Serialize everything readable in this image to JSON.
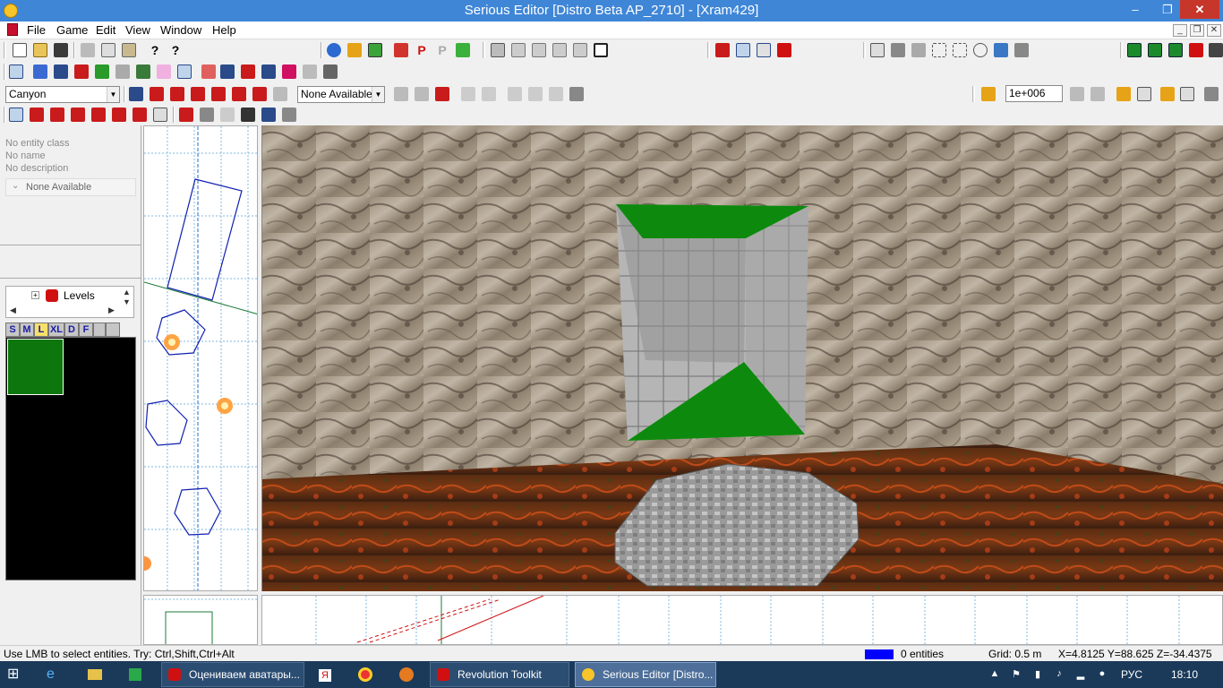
{
  "window": {
    "title": "Serious Editor [Distro Beta AP_2710] - [Xram429]",
    "min_glyph": "–",
    "max_glyph": "❐",
    "close_glyph": "✕"
  },
  "menu": {
    "items": [
      "File",
      "Game",
      "Edit",
      "View",
      "Window",
      "Help"
    ],
    "mdi_min": "_",
    "mdi_restore": "❐",
    "mdi_close": "✕"
  },
  "toolbar": {
    "world_combo": "Canyon",
    "mode_combo": "None Available",
    "num_field": "1e+006"
  },
  "properties": {
    "entity_class": "No entity class",
    "name": "No name",
    "description": "No description",
    "dropdown": "None Available"
  },
  "tree": {
    "root_label": "Levels"
  },
  "browser_tabs": [
    "S",
    "M",
    "L",
    "XL",
    "D",
    "F"
  ],
  "active_tab": "L",
  "status": {
    "hint": "Use LMB to select entities. Try: Ctrl,Shift,Ctrl+Alt",
    "entities": "0 entities",
    "grid": "Grid: 0.5 m",
    "coords": "X=4.8125 Y=88.625 Z=-34.4375"
  },
  "taskbar": {
    "items": [
      {
        "label": "Оцениваем аватары...",
        "icon": "yandex-browser-icon"
      },
      {
        "label": "Revolution Toolkit",
        "icon": "revolution-icon"
      },
      {
        "label": "Serious Editor [Distro...",
        "icon": "serious-editor-icon"
      }
    ],
    "lang": "РУС",
    "clock": "18:10"
  },
  "colors": {
    "titlebar": "#3f86d7",
    "green_face": "#0d8a0d",
    "selection_blue": "#0000ff",
    "taskbar": "#1b3a5a"
  }
}
